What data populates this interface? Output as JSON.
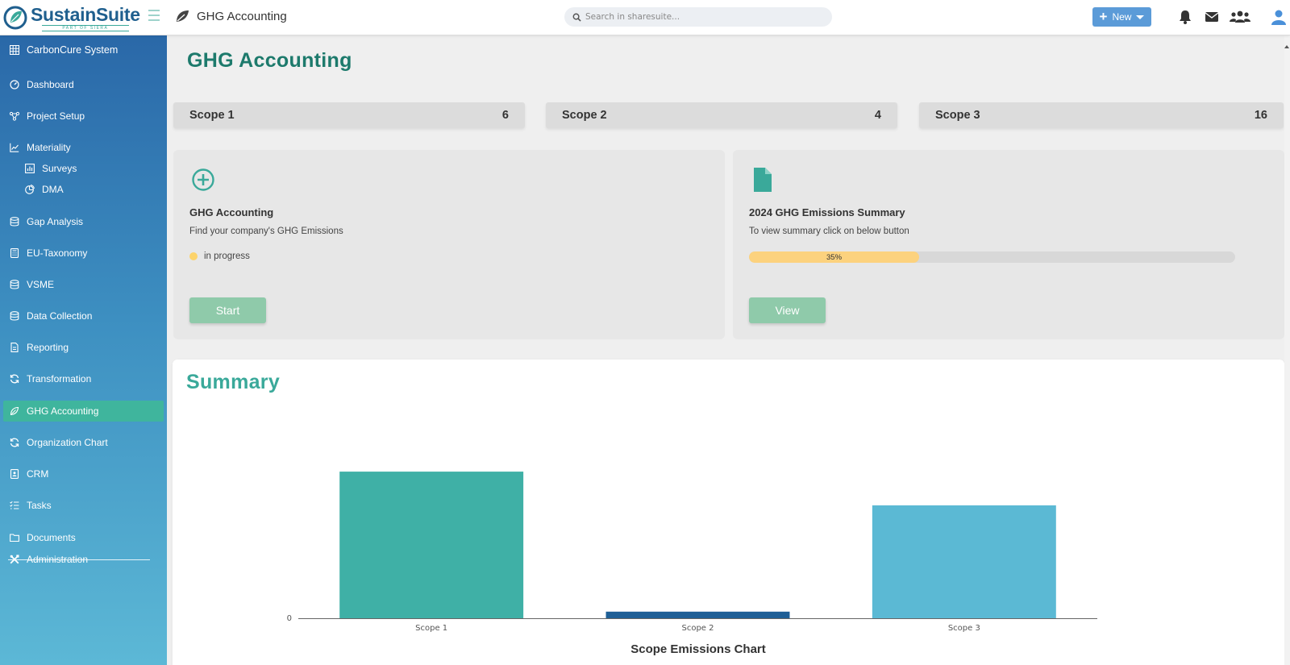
{
  "app": {
    "brand": "SustainSuite",
    "brand_sub": "PART OF SIERA",
    "page_label": "GHG Accounting"
  },
  "search": {
    "placeholder": "Search in sharesuite..."
  },
  "topbar": {
    "new_label": "New",
    "icons": [
      "bell-icon",
      "envelope-icon",
      "users-icon",
      "user-icon"
    ]
  },
  "sidebar": {
    "items": [
      {
        "label": "CarbonCure System",
        "icon": "grid-icon"
      },
      {
        "label": "Dashboard",
        "icon": "gauge-icon"
      },
      {
        "label": "Project Setup",
        "icon": "nodes-icon"
      },
      {
        "label": "Materiality",
        "icon": "line-chart-icon"
      },
      {
        "label": "Surveys",
        "icon": "poll-icon"
      },
      {
        "label": "DMA",
        "icon": "pie-icon"
      },
      {
        "label": "Gap Analysis",
        "icon": "database-icon"
      },
      {
        "label": "EU-Taxonomy",
        "icon": "calculator-icon"
      },
      {
        "label": "VSME",
        "icon": "database-icon"
      },
      {
        "label": "Data Collection",
        "icon": "database-icon"
      },
      {
        "label": "Reporting",
        "icon": "file-icon"
      },
      {
        "label": "Transformation",
        "icon": "refresh-icon"
      },
      {
        "label": "GHG Accounting",
        "icon": "leaf-icon"
      },
      {
        "label": "Organization Chart",
        "icon": "refresh-icon"
      },
      {
        "label": "CRM",
        "icon": "contact-icon"
      },
      {
        "label": "Tasks",
        "icon": "list-check-icon"
      },
      {
        "label": "Documents",
        "icon": "folder-icon"
      },
      {
        "label": "Administration",
        "icon": "tools-icon"
      }
    ],
    "active": "GHG Accounting"
  },
  "main": {
    "title": "GHG Accounting",
    "scopes": [
      {
        "label": "Scope 1",
        "value": "6"
      },
      {
        "label": "Scope 2",
        "value": "4"
      },
      {
        "label": "Scope 3",
        "value": "16"
      }
    ],
    "panel_left": {
      "icon": "plus-circle-icon",
      "title": "GHG Accounting",
      "description": "Find your company's GHG Emissions",
      "status": "in progress",
      "button": "Start"
    },
    "panel_right": {
      "icon": "document-icon",
      "title": "2024 GHG Emissions Summary",
      "description": "To view summary click on below button",
      "progress_percent": 35,
      "progress_label": "35%",
      "button": "View"
    },
    "summary_title": "Summary"
  },
  "chart_data": {
    "type": "bar",
    "title": "Scope Emissions Chart",
    "categories": [
      "Scope 1",
      "Scope 2",
      "Scope 3"
    ],
    "values": [
      100,
      4.5,
      77
    ],
    "ytick_labels": [
      "0"
    ],
    "colors": [
      "#3fb0a6",
      "#1f5f96",
      "#5bb9d4"
    ],
    "ylim": [
      0,
      105
    ]
  }
}
